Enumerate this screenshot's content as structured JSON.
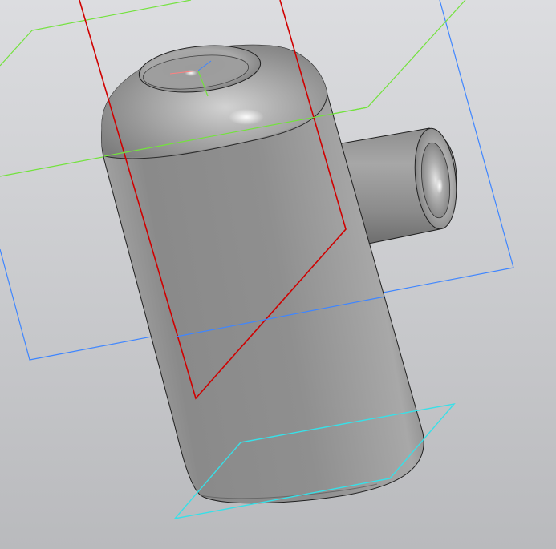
{
  "viewport": {
    "background_top": "#dcdde0",
    "background_bottom": "#b9babd"
  },
  "colors": {
    "plane_xy": "#3f86ff",
    "plane_top": "#73e23d",
    "plane_side": "#d00000",
    "plane_bottom": "#37e0e8",
    "model_light": "#cfcfcf",
    "model_mid": "#9a9a9a",
    "model_dark": "#5e5e5e",
    "edge": "#202020"
  },
  "icons": {
    "origin_triad": "origin-triad-icon"
  }
}
